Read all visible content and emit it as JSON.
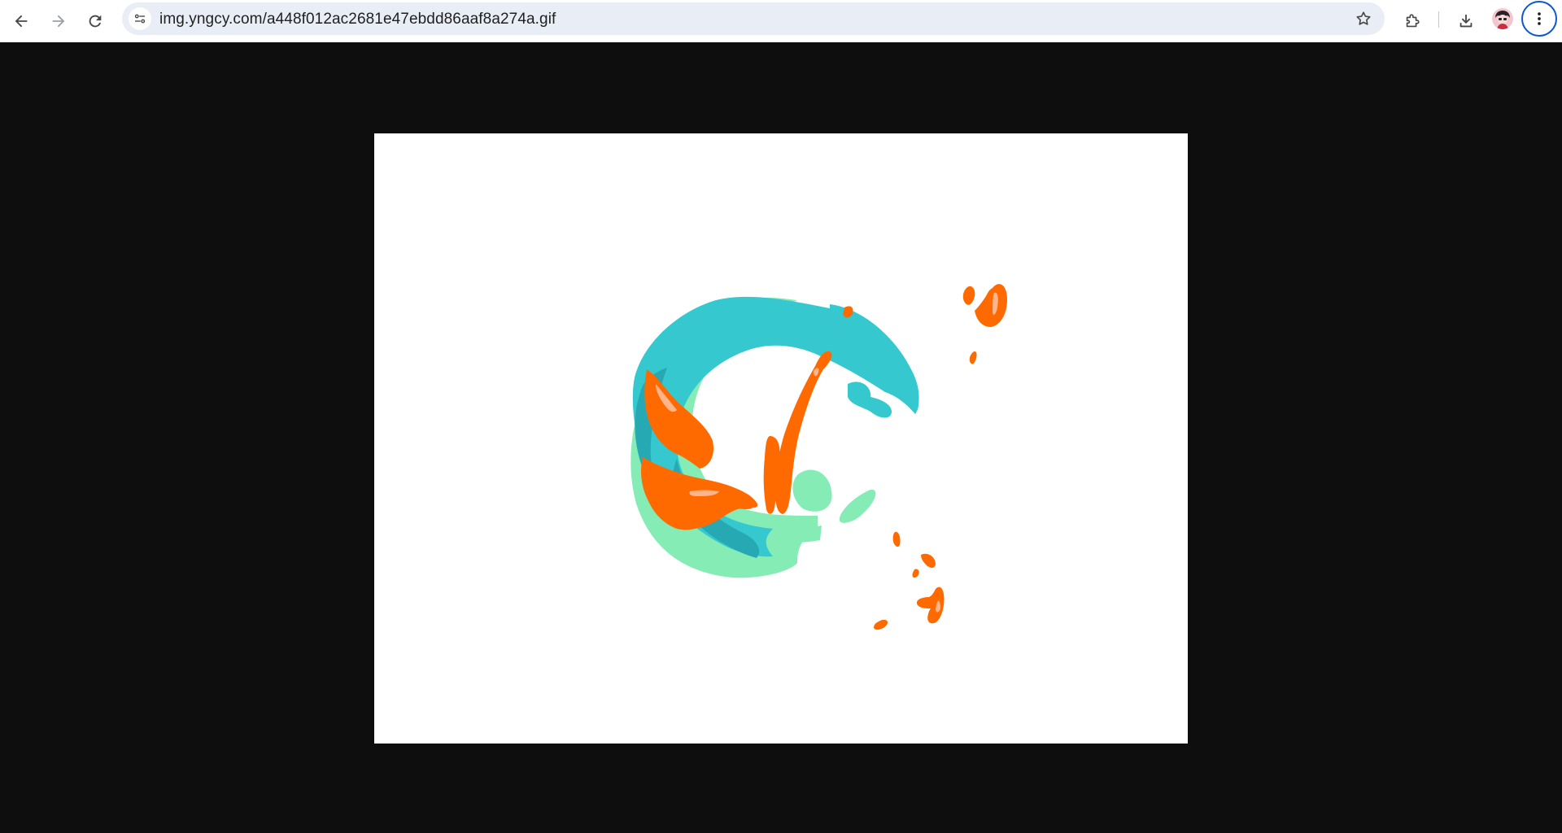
{
  "browser": {
    "url": "img.yngcy.com/a448f012ac2681e47ebdd86aaf8a274a.gif",
    "icons": {
      "back": "arrow-left-icon",
      "forward": "arrow-right-icon",
      "reload": "reload-icon",
      "site_info": "tune-icon",
      "bookmark": "star-icon",
      "extensions": "puzzle-icon",
      "downloads": "download-icon",
      "profile": "avatar",
      "menu": "kebab-menu-icon"
    },
    "colors": {
      "toolbar": "#ffffff",
      "omnibox": "#e9eef6",
      "page_background": "#0e0e0e",
      "menu_ring": "#0b57d0"
    }
  },
  "image": {
    "colors": {
      "teal": "#35c9cf",
      "dark_teal": "#26a9b3",
      "mint": "#86ecb6",
      "orange": "#ff6a00",
      "highlight": "#ffb48a",
      "background": "#ffffff"
    }
  }
}
